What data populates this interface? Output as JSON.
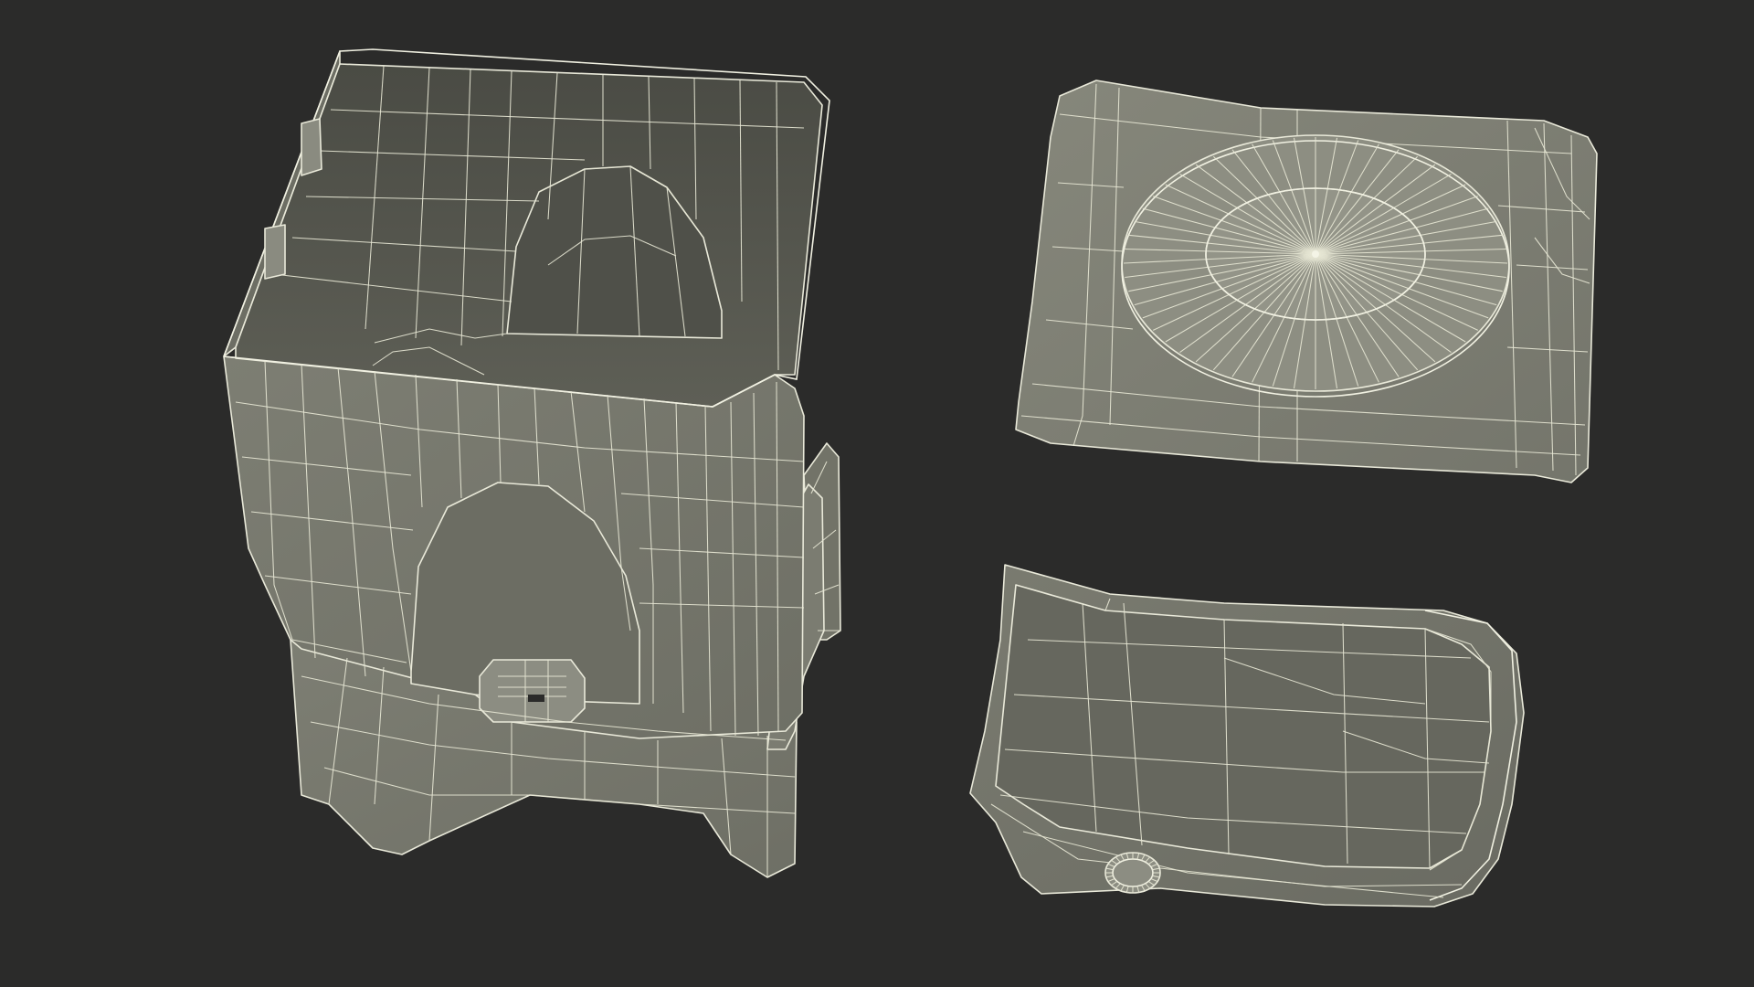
{
  "scene": {
    "background_color": "#2b2b2a",
    "wire_color": "#e9e9d9",
    "surface_outer_color": "#7a7b70",
    "surface_inner_color": "#5a5b52",
    "surface_dark_color": "#44463f"
  },
  "objects": [
    {
      "id": "container-body",
      "part": "body"
    },
    {
      "id": "top-lid",
      "part": "lid"
    },
    {
      "id": "bottom-tray",
      "part": "tray"
    }
  ]
}
